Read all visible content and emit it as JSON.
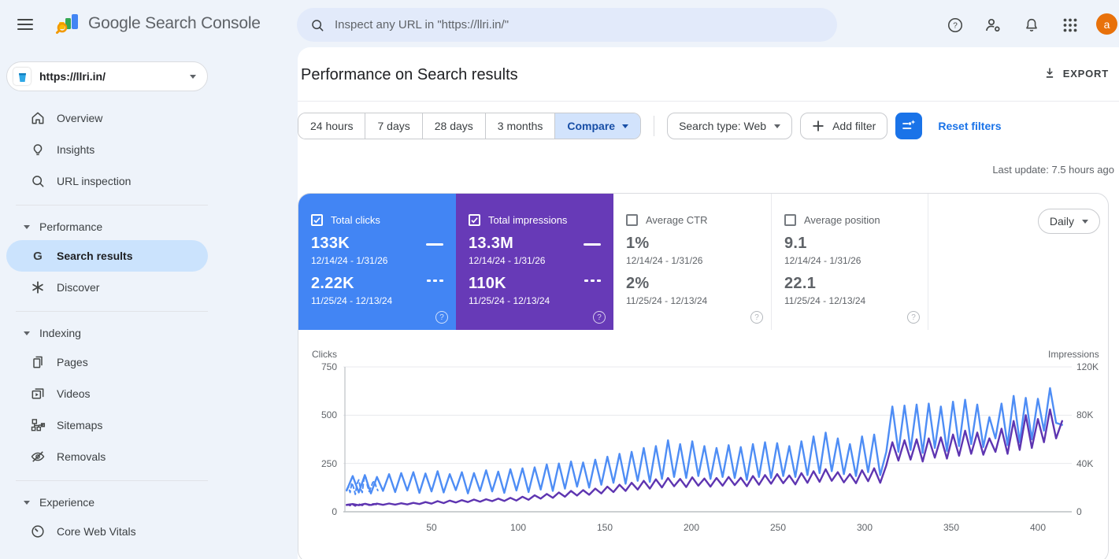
{
  "topbar": {
    "app_title": "Google Search Console",
    "search_placeholder": "Inspect any URL in \"https://llri.in/\"",
    "avatar_letter": "a"
  },
  "property": {
    "url": "https://llri.in/"
  },
  "sidebar": {
    "items": [
      {
        "label": "Overview"
      },
      {
        "label": "Insights"
      },
      {
        "label": "URL inspection"
      },
      {
        "label": "Performance"
      },
      {
        "label": "Search results"
      },
      {
        "label": "Discover"
      },
      {
        "label": "Indexing"
      },
      {
        "label": "Pages"
      },
      {
        "label": "Videos"
      },
      {
        "label": "Sitemaps"
      },
      {
        "label": "Removals"
      },
      {
        "label": "Experience"
      },
      {
        "label": "Core Web Vitals"
      }
    ]
  },
  "header": {
    "title": "Performance on Search results",
    "export_label": "EXPORT"
  },
  "filters": {
    "ranges": [
      "24 hours",
      "7 days",
      "28 days",
      "3 months"
    ],
    "compare_label": "Compare",
    "search_type_label": "Search type: Web",
    "add_filter_label": "Add filter",
    "reset_label": "Reset filters"
  },
  "status": {
    "last_update": "Last update: 7.5 hours ago"
  },
  "metrics": {
    "granularity": "Daily",
    "cards": [
      {
        "label": "Total clicks",
        "checked": true,
        "color": "#4285f4",
        "value1": "133K",
        "range1": "12/14/24 - 1/31/26",
        "value2": "2.22K",
        "range2": "11/25/24 - 12/13/24"
      },
      {
        "label": "Total impressions",
        "checked": true,
        "color": "#673ab7",
        "value1": "13.3M",
        "range1": "12/14/24 - 1/31/26",
        "value2": "110K",
        "range2": "11/25/24 - 12/13/24"
      },
      {
        "label": "Average CTR",
        "checked": false,
        "value1": "1%",
        "range1": "12/14/24 - 1/31/26",
        "value2": "2%",
        "range2": "11/25/24 - 12/13/24"
      },
      {
        "label": "Average position",
        "checked": false,
        "value1": "9.1",
        "range1": "12/14/24 - 1/31/26",
        "value2": "22.1",
        "range2": "11/25/24 - 12/13/24"
      }
    ]
  },
  "chart_data": {
    "type": "line",
    "left_axis": {
      "title": "Clicks",
      "ticks": [
        "750",
        "500",
        "250",
        "0"
      ],
      "tick_values": [
        750,
        500,
        250,
        0
      ],
      "max": 750
    },
    "right_axis": {
      "title": "Impressions",
      "ticks": [
        "120K",
        "80K",
        "40K",
        "0"
      ],
      "tick_values": [
        120000,
        80000,
        40000,
        0
      ],
      "max": 120000
    },
    "x_axis": {
      "ticks": [
        "50",
        "100",
        "150",
        "200",
        "250",
        "300",
        "350",
        "400"
      ],
      "tick_values": [
        50,
        100,
        150,
        200,
        250,
        300,
        350,
        400
      ],
      "range": [
        0,
        420
      ]
    },
    "series": [
      {
        "name": "Total clicks 12/14/24 - 1/31/26",
        "axis": "left",
        "style": "solid",
        "color": "#4e8df5",
        "x_start": 1,
        "x_step": 3.5,
        "values": [
          110,
          185,
          100,
          190,
          95,
          180,
          108,
          195,
          102,
          200,
          110,
          205,
          98,
          198,
          105,
          210,
          100,
          195,
          112,
          205,
          95,
          200,
          108,
          215,
          105,
          208,
          98,
          220,
          110,
          225,
          102,
          230,
          115,
          245,
          108,
          250,
          120,
          260,
          130,
          255,
          125,
          270,
          140,
          285,
          150,
          300,
          145,
          310,
          160,
          330,
          155,
          340,
          170,
          370,
          180,
          350,
          175,
          365,
          185,
          340,
          170,
          330,
          180,
          345,
          175,
          335,
          165,
          350,
          180,
          360,
          175,
          355,
          185,
          340,
          180,
          365,
          190,
          390,
          200,
          410,
          210,
          380,
          195,
          350,
          185,
          390,
          205,
          400,
          190,
          310,
          545,
          310,
          550,
          320,
          555,
          305,
          560,
          330,
          545,
          315,
          570,
          340,
          580,
          350,
          555,
          335,
          490,
          380,
          560,
          345,
          600,
          360,
          590,
          375,
          585,
          420,
          640,
          460,
          450
        ]
      },
      {
        "name": "Total impressions 12/14/24 - 1/31/26",
        "axis": "right",
        "style": "solid",
        "color": "#5e35b1",
        "x_start": 1,
        "x_step": 3.5,
        "values": [
          5760,
          6400,
          5440,
          6560,
          5600,
          6720,
          5760,
          6880,
          5920,
          7040,
          6080,
          7360,
          6400,
          8000,
          6720,
          8800,
          7200,
          9280,
          7680,
          9600,
          8000,
          10080,
          8320,
          10400,
          8800,
          10880,
          8960,
          11520,
          9280,
          12480,
          9920,
          13600,
          10880,
          14720,
          11520,
          16000,
          12480,
          17280,
          13440,
          17920,
          14080,
          19200,
          15200,
          20800,
          16320,
          22400,
          17280,
          24000,
          18400,
          25600,
          19200,
          26880,
          20160,
          28000,
          21120,
          27200,
          20480,
          28480,
          21600,
          27520,
          20800,
          28000,
          21600,
          28800,
          22080,
          28160,
          21120,
          29600,
          22400,
          30400,
          23200,
          31200,
          23680,
          30080,
          22720,
          32000,
          24000,
          33600,
          24800,
          35200,
          25600,
          32800,
          24320,
          31200,
          23680,
          34400,
          25280,
          36000,
          24000,
          38400,
          57600,
          42400,
          59200,
          43200,
          60000,
          41600,
          60800,
          44800,
          61600,
          44000,
          64000,
          46400,
          67200,
          48000,
          65600,
          47200,
          60800,
          49600,
          68800,
          48000,
          75200,
          51200,
          80000,
          52800,
          76800,
          57600,
          84800,
          60800,
          75200
        ]
      },
      {
        "name": "Total clicks 11/25/24 - 12/13/24",
        "axis": "left",
        "style": "dashed",
        "color": "#4e8df5",
        "x_start": 1,
        "x_step": 1,
        "values": [
          115,
          130,
          100,
          150,
          125,
          90,
          145,
          165,
          120,
          100,
          170,
          185,
          135,
          105,
          125,
          150,
          160,
          130,
          110
        ]
      },
      {
        "name": "Total impressions 11/25/24 - 12/13/24",
        "axis": "right",
        "style": "dashed",
        "color": "#5e35b1",
        "x_start": 1,
        "x_step": 1,
        "values": [
          5440,
          5760,
          5120,
          6080,
          5600,
          4800,
          5920,
          6400,
          5760,
          5280,
          6240,
          6720,
          6080,
          5440,
          5760,
          6400,
          6560,
          5920,
          5600
        ]
      }
    ]
  }
}
